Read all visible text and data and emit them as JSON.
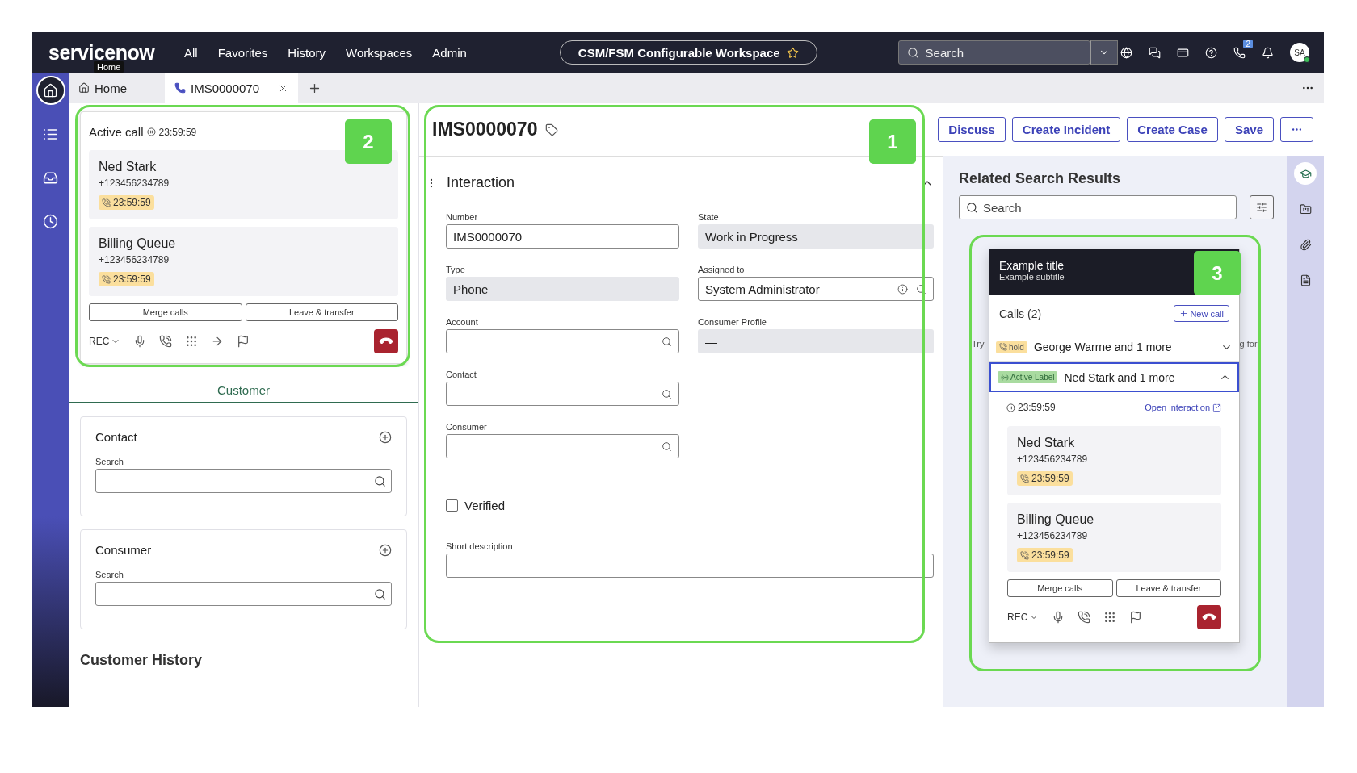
{
  "topbar": {
    "logo": "servicenow",
    "logo_tooltip": "Home",
    "nav": [
      "All",
      "Favorites",
      "History",
      "Workspaces",
      "Admin"
    ],
    "workspace": "CSM/FSM Configurable Workspace",
    "search": {
      "placeholder": "Search"
    },
    "icons": [
      {
        "kind": "globe"
      },
      {
        "kind": "chat"
      },
      {
        "kind": "card"
      },
      {
        "kind": "help"
      },
      {
        "kind": "phone",
        "count": "2"
      },
      {
        "kind": "bell"
      }
    ],
    "avatar": "SA"
  },
  "tabs": [
    {
      "label": "Home",
      "kind": "home",
      "selected": false
    },
    {
      "label": "IMS0000070",
      "kind": "record",
      "selected": true
    }
  ],
  "nav_rail": [
    {
      "kind": "home",
      "selected": true
    },
    {
      "kind": "list",
      "selected": false
    },
    {
      "kind": "inbox",
      "selected": false
    },
    {
      "kind": "clock",
      "selected": false
    }
  ],
  "active_call": {
    "title": "Active call",
    "timer": "23:59:59",
    "calls": [
      {
        "name": "Ned Stark",
        "phone": "+123456234789",
        "duration": "23:59:59"
      },
      {
        "name": "Billing Queue",
        "phone": "+123456234789",
        "duration": "23:59:59"
      }
    ],
    "buttons": [
      "Merge calls",
      "Leave & transfer"
    ],
    "rec": "REC",
    "tools": [
      {
        "kind": "mic"
      },
      {
        "kind": "hold"
      },
      {
        "kind": "keypad"
      },
      {
        "kind": "transfer"
      },
      {
        "kind": "flag"
      }
    ]
  },
  "customer_tabs": [
    {
      "label": "Customer",
      "selected": true
    }
  ],
  "sections": [
    {
      "title": "Contact",
      "search_label": "Search"
    },
    {
      "title": "Consumer",
      "search_label": "Search"
    }
  ],
  "customer_history": "Customer History",
  "record": {
    "title": "IMS0000070",
    "section": "Interaction",
    "expanded": true,
    "left_fields": [
      {
        "label": "Number",
        "value": "IMS0000070",
        "kind": "text"
      },
      {
        "label": "Type",
        "value": "Phone",
        "kind": "readonly"
      },
      {
        "label": "Account",
        "kind": "lookup"
      },
      {
        "label": "Contact",
        "kind": "lookup"
      },
      {
        "label": "Consumer",
        "kind": "lookup"
      }
    ],
    "right_fields": [
      {
        "label": "State",
        "value": "Work in Progress",
        "kind": "readonly"
      },
      {
        "label": "Assigned to",
        "value": "System Administrator",
        "kind": "reference"
      },
      {
        "label": "Consumer Profile",
        "value": "—",
        "kind": "readonly"
      }
    ],
    "verified": {
      "label": "Verified",
      "checked": false
    },
    "short_description": {
      "label": "Short description"
    }
  },
  "actions": [
    "Discuss",
    "Create Incident",
    "Create Case",
    "Save"
  ],
  "related": {
    "title": "Related Search Results",
    "search": {
      "placeholder": "Search"
    },
    "hint_left": "Try",
    "hint_right": "g for."
  },
  "right_rail": [
    {
      "kind": "learn",
      "selected": true
    },
    {
      "kind": "folder",
      "selected": false
    },
    {
      "kind": "clip",
      "selected": false
    },
    {
      "kind": "doc",
      "selected": false
    }
  ],
  "phone_widget": {
    "title": "Example title",
    "subtitle": "Example subtitle",
    "calls_heading": "Calls (2)",
    "new_call": "New call",
    "groups": [
      {
        "status": "hold",
        "kind": "hold",
        "label": "George Warrne and 1 more",
        "expanded": false
      },
      {
        "status": "Active Label",
        "kind": "active",
        "label": "Ned Stark and 1 more",
        "expanded": true
      }
    ],
    "timer": "23:59:59",
    "open_link": "Open interaction",
    "calls": [
      {
        "name": "Ned Stark",
        "phone": "+123456234789",
        "duration": "23:59:59"
      },
      {
        "name": "Billing Queue",
        "phone": "+123456234789",
        "duration": "23:59:59"
      }
    ],
    "buttons": [
      "Merge calls",
      "Leave & transfer"
    ],
    "rec": "REC",
    "tools": [
      {
        "kind": "mic"
      },
      {
        "kind": "hold"
      },
      {
        "kind": "keypad"
      },
      {
        "kind": "flag"
      }
    ]
  },
  "annotations": [
    {
      "label": "1"
    },
    {
      "label": "2"
    },
    {
      "label": "3"
    }
  ]
}
